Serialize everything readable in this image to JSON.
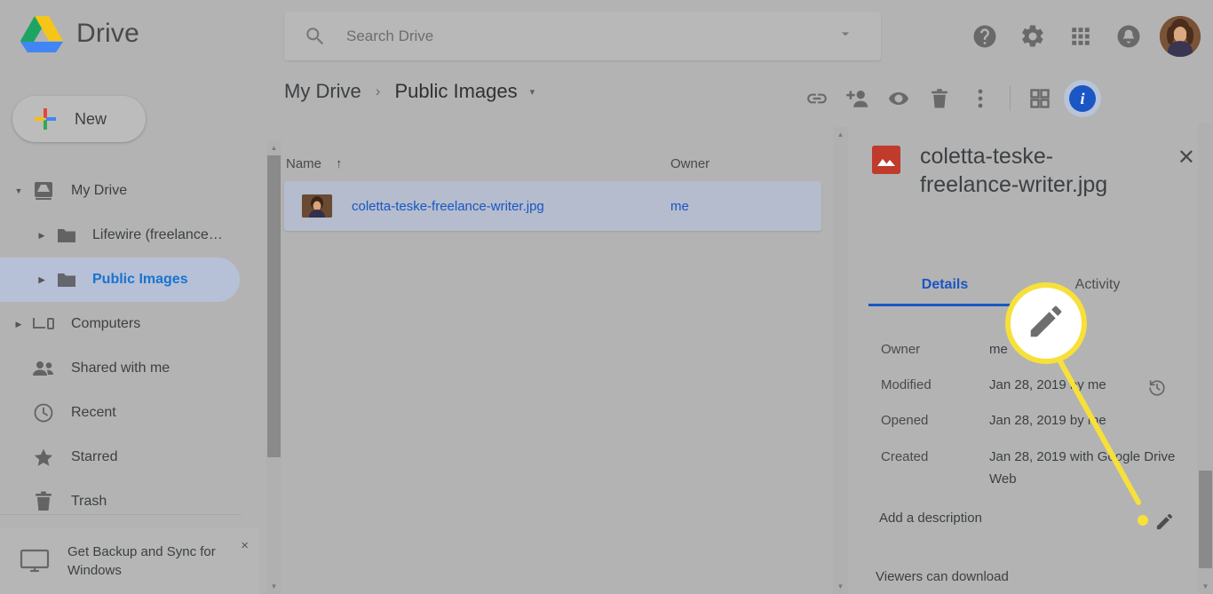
{
  "app": {
    "brand": "Drive"
  },
  "search": {
    "placeholder": "Search Drive",
    "value": "",
    "icon": "search-icon",
    "caret": "search-options-caret"
  },
  "topicons": [
    {
      "name": "help-icon",
      "label": "?"
    },
    {
      "name": "settings-gear-icon",
      "label": ""
    },
    {
      "name": "apps-grid-icon",
      "label": ""
    },
    {
      "name": "notifications-bell-icon",
      "label": ""
    },
    {
      "name": "account-avatar",
      "label": ""
    }
  ],
  "sidebar": {
    "new_button": "New",
    "items": [
      {
        "label": "My Drive",
        "icon": "my-drive-icon",
        "level": 0,
        "twisty": "expanded",
        "selected": false
      },
      {
        "label": "Lifewire (freelance…",
        "icon": "folder-icon",
        "level": 1,
        "twisty": "collapsed",
        "selected": false
      },
      {
        "label": "Public Images",
        "icon": "folder-icon",
        "level": 1,
        "twisty": "collapsed",
        "selected": true
      },
      {
        "label": "Computers",
        "icon": "computers-icon",
        "level": 0,
        "twisty": "collapsed",
        "selected": false
      },
      {
        "label": "Shared with me",
        "icon": "people-icon",
        "level": 0,
        "twisty": "none",
        "selected": false
      },
      {
        "label": "Recent",
        "icon": "clock-icon",
        "level": 0,
        "twisty": "none",
        "selected": false
      },
      {
        "label": "Starred",
        "icon": "star-icon",
        "level": 0,
        "twisty": "none",
        "selected": false
      },
      {
        "label": "Trash",
        "icon": "trash-icon",
        "level": 0,
        "twisty": "none",
        "selected": false
      }
    ],
    "backup": {
      "text": "Get Backup and Sync for Windows",
      "close": "×",
      "icon": "monitor-icon"
    }
  },
  "breadcrumb": {
    "root": "My Drive",
    "separator": "›",
    "current": "Public Images",
    "caret": "▾"
  },
  "toolbar": [
    {
      "name": "get-link-icon"
    },
    {
      "name": "add-person-icon"
    },
    {
      "name": "preview-eye-icon"
    },
    {
      "name": "remove-trash-icon"
    },
    {
      "name": "more-actions-icon"
    },
    {
      "name": "grid-view-icon"
    },
    {
      "name": "details-info-icon",
      "label": "i"
    }
  ],
  "filelist": {
    "columns": {
      "name": "Name",
      "sort": "↑",
      "owner": "Owner"
    },
    "rows": [
      {
        "name": "coletta-teske-freelance-writer.jpg",
        "owner": "me",
        "thumb": "photo-thumbnail",
        "selected": true
      }
    ]
  },
  "details": {
    "filename": "coletta-teske-freelance-writer.jpg",
    "file_icon": "image-file-icon",
    "close": "✕",
    "tabs": [
      {
        "label": "Details",
        "active": true
      },
      {
        "label": "Activity",
        "active": false
      }
    ],
    "metadata": [
      {
        "key": "Owner",
        "value": "me",
        "action": ""
      },
      {
        "key": "Modified",
        "value": "Jan 28, 2019 by me",
        "action": "version-history-icon"
      },
      {
        "key": "Opened",
        "value": "Jan 28, 2019 by me",
        "action": ""
      },
      {
        "key": "Created",
        "value": "Jan 28, 2019 with Google Drive Web",
        "action": ""
      }
    ],
    "description_placeholder": "Add a description",
    "description_edit_icon": "edit-pencil-icon",
    "viewers_label": "Viewers can download"
  },
  "callout": {
    "icon": "edit-pencil-icon",
    "ring_color": "#f7e03a"
  },
  "colors": {
    "accent_blue": "#1a56c4",
    "selection": "#b4bccd",
    "page_overlay": "#b3b3b3",
    "file_red": "#c03b2b"
  }
}
